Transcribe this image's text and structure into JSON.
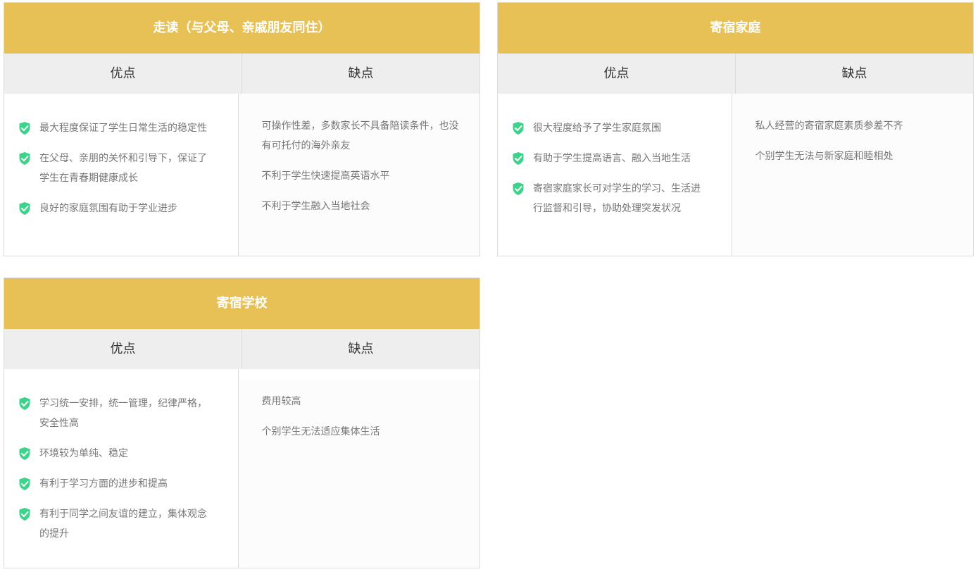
{
  "theme": {
    "header_color": "#e7c156",
    "check_color": "#3fd28a"
  },
  "cards": [
    {
      "title": "走读（与父母、亲戚朋友同住）",
      "pros_label": "优点",
      "cons_label": "缺点",
      "pros": [
        "最大程度保证了学生日常生活的稳定性",
        "在父母、亲朋的关怀和引导下，保证了学生在青春期健康成长",
        "良好的家庭氛围有助于学业进步"
      ],
      "cons": [
        "可操作性差，多数家长不具备陪读条件，也没有可托付的海外亲友",
        "不利于学生快速提高英语水平",
        "不利于学生融入当地社会"
      ]
    },
    {
      "title": "寄宿家庭",
      "pros_label": "优点",
      "cons_label": "缺点",
      "pros": [
        "很大程度给予了学生家庭氛围",
        "有助于学生提高语言、融入当地生活",
        "寄宿家庭家长可对学生的学习、生活进行监督和引导，协助处理突发状况"
      ],
      "cons": [
        "私人经营的寄宿家庭素质参差不齐",
        "个别学生无法与新家庭和睦相处"
      ]
    },
    {
      "title": "寄宿学校",
      "pros_label": "优点",
      "cons_label": "缺点",
      "pros": [
        "学习统一安排，统一管理，纪律严格，安全性高",
        "环境较为单纯、稳定",
        "有利于学习方面的进步和提高",
        "有利于同学之间友谊的建立，集体观念的提升"
      ],
      "cons": [
        "费用较高",
        "个别学生无法适应集体生活"
      ]
    }
  ]
}
